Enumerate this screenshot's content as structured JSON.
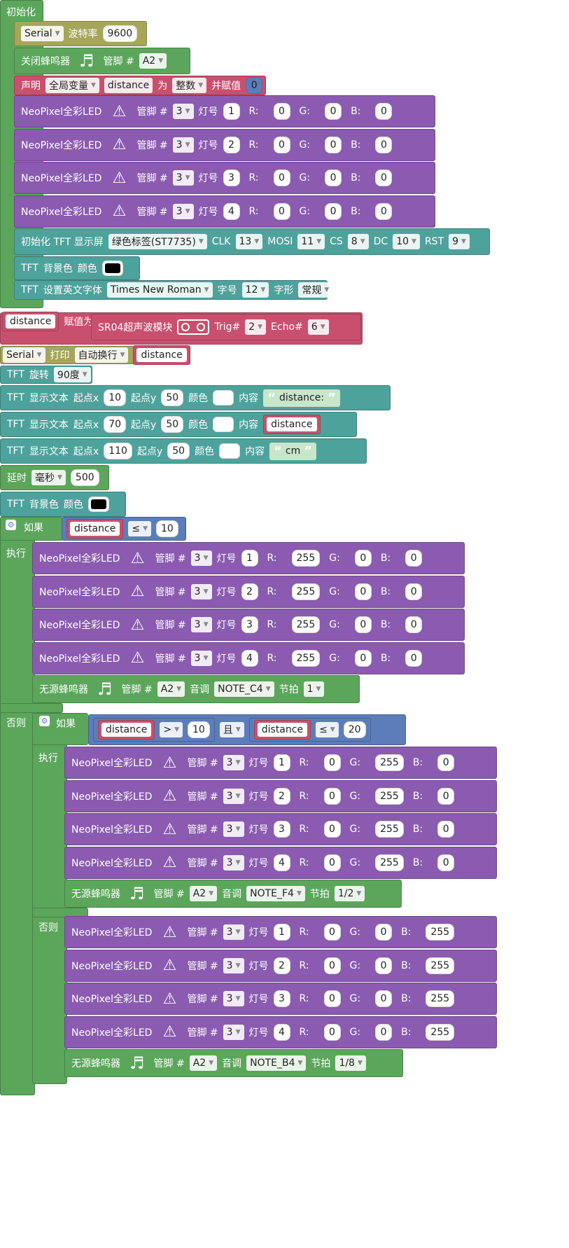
{
  "colors": {
    "green": "#5ba65b",
    "purple": "#8a5bb0",
    "teal": "#4ea29c",
    "olive": "#a6a65a",
    "pink": "#c8506e",
    "blue": "#5c7dba"
  },
  "init": {
    "label": "初始化",
    "serial": {
      "name": "Serial",
      "baud_label": "波特率",
      "baud": "9600"
    },
    "buzzer_off": {
      "label": "关闭蜂鸣器",
      "pin_label": "管脚 #",
      "pin": "A2"
    },
    "declare": {
      "label": "声明",
      "scope": "全局变量",
      "var": "distance",
      "as_label": "为",
      "type": "整数",
      "assign_label": "并赋值",
      "value": "0"
    },
    "neo_rows": [
      {
        "pin": "3",
        "index": "1",
        "r": "0",
        "g": "0",
        "b": "0"
      },
      {
        "pin": "3",
        "index": "2",
        "r": "0",
        "g": "0",
        "b": "0"
      },
      {
        "pin": "3",
        "index": "3",
        "r": "0",
        "g": "0",
        "b": "0"
      },
      {
        "pin": "3",
        "index": "4",
        "r": "0",
        "g": "0",
        "b": "0"
      }
    ],
    "tft_init": {
      "label": "初始化 TFT 显示屏",
      "model": "绿色标签(ST7735)",
      "clk_label": "CLK",
      "clk": "13",
      "mosi_label": "MOSI",
      "mosi": "11",
      "cs_label": "CS",
      "cs": "8",
      "dc_label": "DC",
      "dc": "10",
      "rst_label": "RST",
      "rst": "9"
    },
    "tft_bg": {
      "label": "TFT",
      "bg_label": "背景色",
      "color_label": "颜色"
    },
    "tft_font": {
      "label": "TFT",
      "set_label": "设置英文字体",
      "font": "Times New Roman",
      "size_label": "字号",
      "size": "12",
      "style_label": "字形",
      "style": "常规"
    }
  },
  "neo_labels": {
    "name": "NeoPixel全彩LED",
    "pin": "管脚 #",
    "index": "灯号",
    "r": "R:",
    "g": "G:",
    "b": "B:"
  },
  "assign": {
    "var": "distance",
    "label": "赋值为",
    "module": "SR04超声波模块",
    "trig_label": "Trig#",
    "trig": "2",
    "echo_label": "Echo#",
    "echo": "6"
  },
  "serial_print": {
    "name": "Serial",
    "print_label": "打印",
    "mode": "自动换行",
    "var": "distance"
  },
  "tft_rotate": {
    "label": "TFT",
    "rotate_label": "旋转",
    "value": "90度"
  },
  "tft_texts": [
    {
      "label": "TFT",
      "show_label": "显示文本",
      "x_label": "起点x",
      "x": "10",
      "y_label": "起点y",
      "y": "50",
      "color_label": "颜色",
      "content_label": "内容",
      "text": "distance:"
    },
    {
      "label": "TFT",
      "show_label": "显示文本",
      "x_label": "起点x",
      "x": "70",
      "y_label": "起点y",
      "y": "50",
      "color_label": "颜色",
      "content_label": "内容",
      "var": "distance"
    },
    {
      "label": "TFT",
      "show_label": "显示文本",
      "x_label": "起点x",
      "x": "110",
      "y_label": "起点y",
      "y": "50",
      "color_label": "颜色",
      "content_label": "内容",
      "text": "cm"
    }
  ],
  "delay": {
    "label": "延时",
    "unit": "毫秒",
    "value": "500"
  },
  "tft_bg2": {
    "label": "TFT",
    "bg_label": "背景色",
    "color_label": "颜色"
  },
  "if1": {
    "if_label": "如果",
    "do_label": "执行",
    "else_label": "否则",
    "var": "distance",
    "op": "≤",
    "value": "10",
    "neo_rows": [
      {
        "pin": "3",
        "index": "1",
        "r": "255",
        "g": "0",
        "b": "0"
      },
      {
        "pin": "3",
        "index": "2",
        "r": "255",
        "g": "0",
        "b": "0"
      },
      {
        "pin": "3",
        "index": "3",
        "r": "255",
        "g": "0",
        "b": "0"
      },
      {
        "pin": "3",
        "index": "4",
        "r": "255",
        "g": "0",
        "b": "0"
      }
    ],
    "tone": {
      "label": "无源蜂鸣器",
      "pin_label": "管脚 #",
      "pin": "A2",
      "tone_label": "音调",
      "note": "NOTE_C4",
      "beat_label": "节拍",
      "beat": "1"
    }
  },
  "if2": {
    "if_label": "如果",
    "do_label": "执行",
    "else_label": "否则",
    "var1": "distance",
    "op1": ">",
    "val1": "10",
    "and_label": "且",
    "var2": "distance",
    "op2": "≤",
    "val2": "20",
    "neo_rows": [
      {
        "pin": "3",
        "index": "1",
        "r": "0",
        "g": "255",
        "b": "0"
      },
      {
        "pin": "3",
        "index": "2",
        "r": "0",
        "g": "255",
        "b": "0"
      },
      {
        "pin": "3",
        "index": "3",
        "r": "0",
        "g": "255",
        "b": "0"
      },
      {
        "pin": "3",
        "index": "4",
        "r": "0",
        "g": "255",
        "b": "0"
      }
    ],
    "tone": {
      "label": "无源蜂鸣器",
      "pin_label": "管脚 #",
      "pin": "A2",
      "tone_label": "音调",
      "note": "NOTE_F4",
      "beat_label": "节拍",
      "beat": "1/2"
    },
    "else_neo_rows": [
      {
        "pin": "3",
        "index": "1",
        "r": "0",
        "g": "0",
        "b": "255"
      },
      {
        "pin": "3",
        "index": "2",
        "r": "0",
        "g": "0",
        "b": "255"
      },
      {
        "pin": "3",
        "index": "3",
        "r": "0",
        "g": "0",
        "b": "255"
      },
      {
        "pin": "3",
        "index": "4",
        "r": "0",
        "g": "0",
        "b": "255"
      }
    ],
    "else_tone": {
      "label": "无源蜂鸣器",
      "pin_label": "管脚 #",
      "pin": "A2",
      "tone_label": "音调",
      "note": "NOTE_B4",
      "beat_label": "节拍",
      "beat": "1/8"
    }
  }
}
